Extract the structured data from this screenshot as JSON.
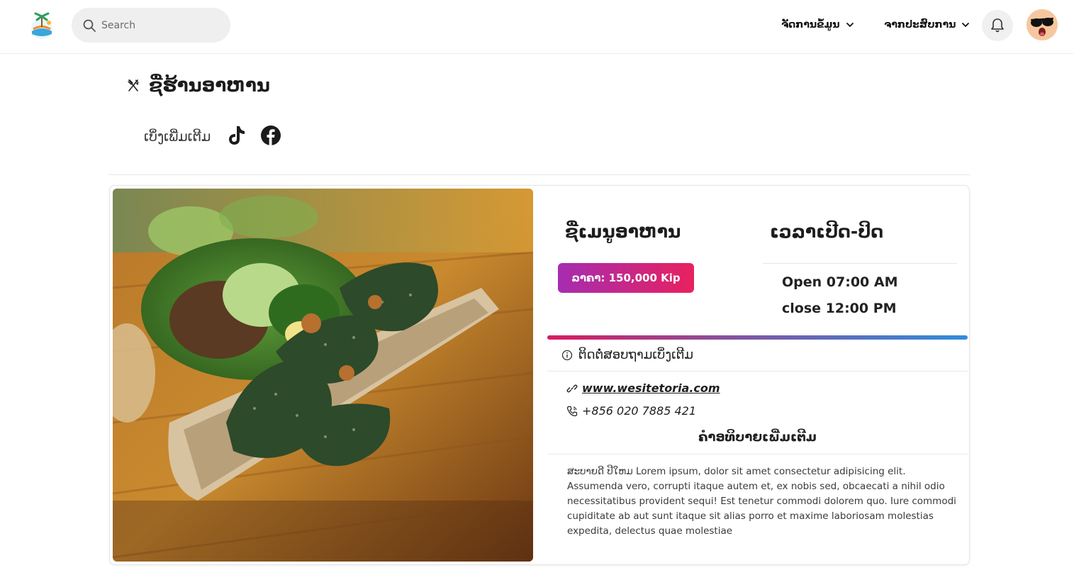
{
  "nav": {
    "search_placeholder": "Search",
    "menu_manage": "ຈັດການຂໍ້ມູນ",
    "menu_experience": "ຈາກປະສົບການ",
    "icons": {
      "bell": "bell-icon",
      "chevron": "chevron-down-icon",
      "search": "search-icon"
    }
  },
  "page": {
    "title": "ຊື່ຮ້ານອາຫານ",
    "see_more": "ເບິ່ງເພີ່ມເຕີມ",
    "icons": {
      "title": "utensils-icon",
      "tiktok": "tiktok-icon",
      "facebook": "facebook-icon"
    }
  },
  "card": {
    "menu_name": "ຊື່ເມນູອາຫານ",
    "price_label": "ລາຄາ: 150,000 Kip",
    "hours_title": "ເວລາເປີດ-ປິດ",
    "open_time": "Open 07:00 AM",
    "close_time": "close 12:00 PM",
    "contact_title": "ຕິດຕໍ່ສອບຖາມເບິ່ງເຕີມ",
    "website": "www.wesitetoria.com",
    "phone": "+856 020 7885 421",
    "desc_title": "ຄຳອທິບາຍເພີ່ມເຕີມ",
    "description": "ສະບາຍດີ ປີໃຫມ Lorem ipsum, dolor sit amet consectetur adipisicing elit. Assumenda vero, corrupti itaque autem et, ex nobis sed, obcaecati a nihil odio necessitatibus provident sequi! Est tenetur commodi dolorem quo. Iure commodi cupiditate ab aut sunt itaque sit alias porro et maxime laboriosam molestias expedita, delectus quae molestiae"
  },
  "colors": {
    "price_gradient_start": "#a52db0",
    "price_gradient_end": "#e8215f",
    "bar_gradient_start": "#d81b60",
    "bar_gradient_end": "#2f8ddb"
  }
}
